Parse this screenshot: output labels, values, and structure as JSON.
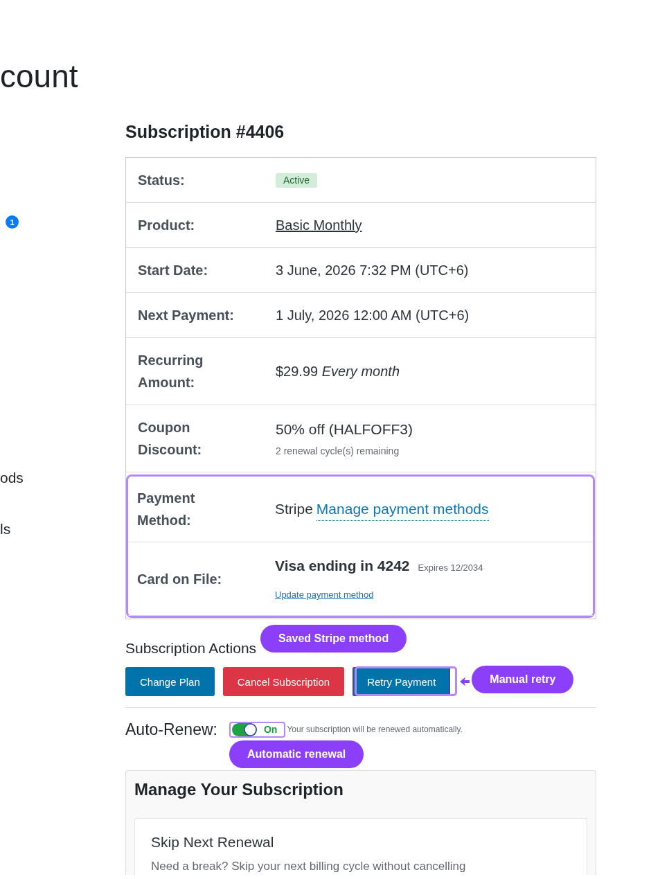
{
  "page_title": "count",
  "sidebar": {
    "badge": "1",
    "items": [
      "ods",
      "ls"
    ]
  },
  "subscription": {
    "title": "Subscription #4406",
    "rows": [
      {
        "label": "Status:",
        "kind": "badge",
        "value": "Active"
      },
      {
        "label": "Product:",
        "kind": "link",
        "value": "Basic Monthly"
      },
      {
        "label": "Start Date:",
        "kind": "text",
        "value": "3 June, 2026 7:32 PM (UTC+6)"
      },
      {
        "label": "Next Payment:",
        "kind": "text",
        "value": "1 July, 2026 12:00 AM (UTC+6)"
      },
      {
        "label": "Recurring Amount:",
        "kind": "text",
        "value": "$29.99 *Every month*"
      },
      {
        "label": "Coupon Discount:",
        "kind": "coupon",
        "value": "50% off (HALFOFF3)",
        "note": "2 renewal cycle(s) remaining"
      }
    ],
    "highlighted_rows": [
      {
        "label": "Payment Method:",
        "kind": "method",
        "value": "Stripe",
        "link": "Manage payment methods"
      },
      {
        "label": "Card on File:",
        "kind": "card",
        "value": "Visa ending in 4242",
        "note": "Expires 12/2034",
        "link": "Update payment method"
      }
    ],
    "callout": "Saved Stripe method"
  },
  "actions": {
    "title": "Subscription Actions",
    "buttons": [
      {
        "label": "Change Plan",
        "kind": "primary",
        "highlighted": false
      },
      {
        "label": "Cancel Subscription",
        "kind": "danger",
        "highlighted": false
      },
      {
        "label": "Retry Payment",
        "kind": "primary",
        "highlighted": true,
        "callout": "Manual retry"
      }
    ]
  },
  "auto_renew": {
    "label": "Auto-Renew:",
    "on": true,
    "state_label": "On",
    "highlighted": true,
    "description": "Your subscription will be renewed automatically.",
    "callout": "Automatic renewal"
  },
  "manage": {
    "title": "Manage Your Subscription",
    "options": [
      {
        "title": "Skip Next Renewal",
        "description": "Need a break? Skip your next billing cycle without cancelling"
      }
    ]
  }
}
